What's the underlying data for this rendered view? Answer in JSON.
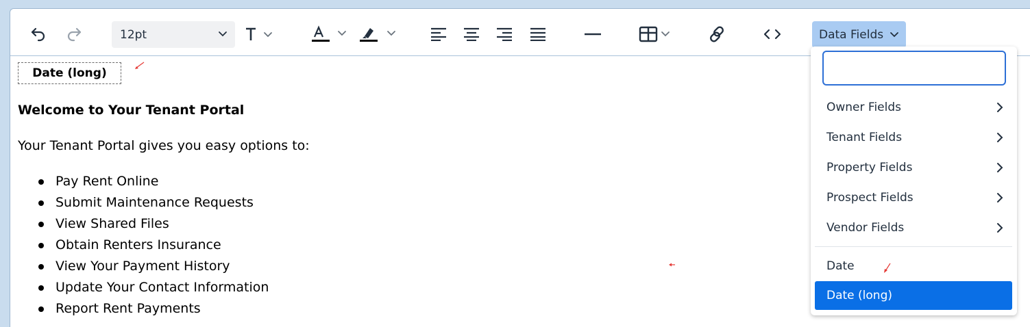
{
  "toolbar": {
    "font_size": "12pt",
    "data_fields_label": "Data Fields",
    "icons": [
      "undo-icon",
      "redo-icon",
      "text-format-icon",
      "text-color-icon",
      "highlight-icon",
      "align-left-icon",
      "align-center-icon",
      "align-right-icon",
      "justify-icon",
      "horizontal-line-icon",
      "table-icon",
      "link-icon",
      "source-code-icon"
    ]
  },
  "content": {
    "chip_label": "Date (long)",
    "welcome": "Welcome to Your Tenant Portal",
    "intro": "Your Tenant Portal gives you easy options to:",
    "bullets": [
      "Pay Rent Online",
      "Submit Maintenance Requests",
      "View Shared Files",
      "Obtain Renters Insurance",
      "View Your Payment History",
      "Update Your Contact Information",
      "Report Rent Payments"
    ]
  },
  "dropdown": {
    "search_value": "",
    "items": [
      {
        "label": "Owner Fields",
        "submenu": true
      },
      {
        "label": "Tenant Fields",
        "submenu": true
      },
      {
        "label": "Property Fields",
        "submenu": true
      },
      {
        "label": "Prospect Fields",
        "submenu": true
      },
      {
        "label": "Vendor Fields",
        "submenu": true
      }
    ],
    "date_item": "Date",
    "selected_item": "Date (long)"
  },
  "colors": {
    "accent": "#0a6fe6",
    "data_fields_bg": "#a9cbf2",
    "marker": "#e53935"
  }
}
